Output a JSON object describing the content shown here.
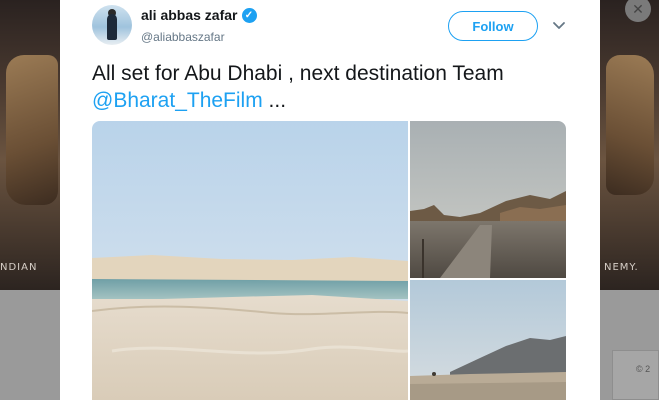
{
  "background": {
    "left_caption": "NDIAN",
    "right_caption": "NEMY.",
    "copyright": "© 2",
    "close_glyph": "✕"
  },
  "tweet": {
    "display_name": "ali abbas zafar",
    "verified_icon": "verified-badge-icon",
    "verified_glyph": "✓",
    "handle": "@aliabbaszafar",
    "follow_label": "Follow",
    "text_plain": "All set for Abu Dhabi , next destination Team ",
    "mention": "@Bharat_TheFilm",
    "text_suffix": " ..."
  },
  "media": {
    "photos": [
      {
        "name": "desert-lake-photo"
      },
      {
        "name": "desert-mountain-road-photo"
      },
      {
        "name": "desert-plain-mountains-photo"
      }
    ]
  },
  "colors": {
    "accent": "#1da1f2",
    "text": "#14171a",
    "secondary_text": "#657786"
  }
}
